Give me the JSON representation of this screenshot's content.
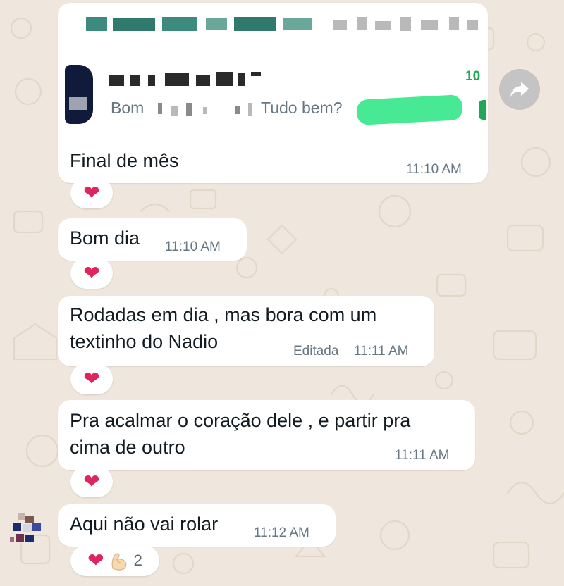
{
  "colors": {
    "background": "#efe7dd",
    "bubble": "#ffffff",
    "text": "#111b21",
    "meta": "#667781",
    "accent_green": "#25d366",
    "heart": "#e0245e"
  },
  "quoted_message": {
    "partial_time": "10",
    "preview_start": "Bom",
    "preview_end": "Tudo bem?"
  },
  "messages": [
    {
      "text": "Final de mês",
      "time": "11:10 AM",
      "reaction_icons": [
        "heart-icon"
      ]
    },
    {
      "text": "Bom dia",
      "time": "11:10 AM",
      "reaction_icons": [
        "heart-icon"
      ]
    },
    {
      "text": "Rodadas em dia , mas bora com um\ntextinho do Nadio",
      "edited_label": "Editada",
      "time": "11:11 AM",
      "reaction_icons": [
        "heart-icon"
      ]
    },
    {
      "text": "Pra acalmar o coração dele , e partir pra\ncima de outro",
      "time": "11:11 AM",
      "reaction_icons": [
        "heart-icon"
      ]
    },
    {
      "text": "Aqui não vai rolar",
      "time": "11:12 AM",
      "reaction_icons": [
        "heart-icon",
        "flexed-biceps-icon"
      ],
      "reaction_count": "2"
    }
  ],
  "forward_icon": "forward-arrow-icon"
}
